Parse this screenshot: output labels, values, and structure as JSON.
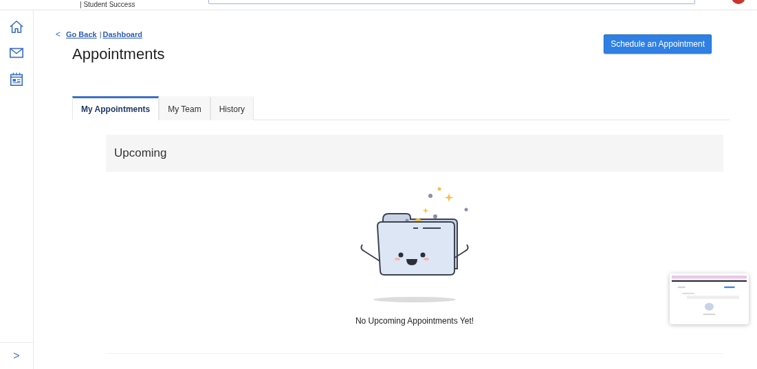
{
  "header": {
    "app_name": "| Student Success"
  },
  "back_link": {
    "icon": "<",
    "go_back": "Go Back",
    "separator": "|",
    "dashboard": "Dashboard"
  },
  "page_title": "Appointments",
  "primary_button": "Schedule an Appointment",
  "tabs": [
    {
      "label": "My Appointments",
      "selected": true
    },
    {
      "label": "My Team",
      "selected": false
    },
    {
      "label": "History",
      "selected": false
    }
  ],
  "section": {
    "title": "Upcoming",
    "empty_message": "No Upcoming Appointments Yet!"
  },
  "sidebar": {
    "expand_icon": ">"
  }
}
